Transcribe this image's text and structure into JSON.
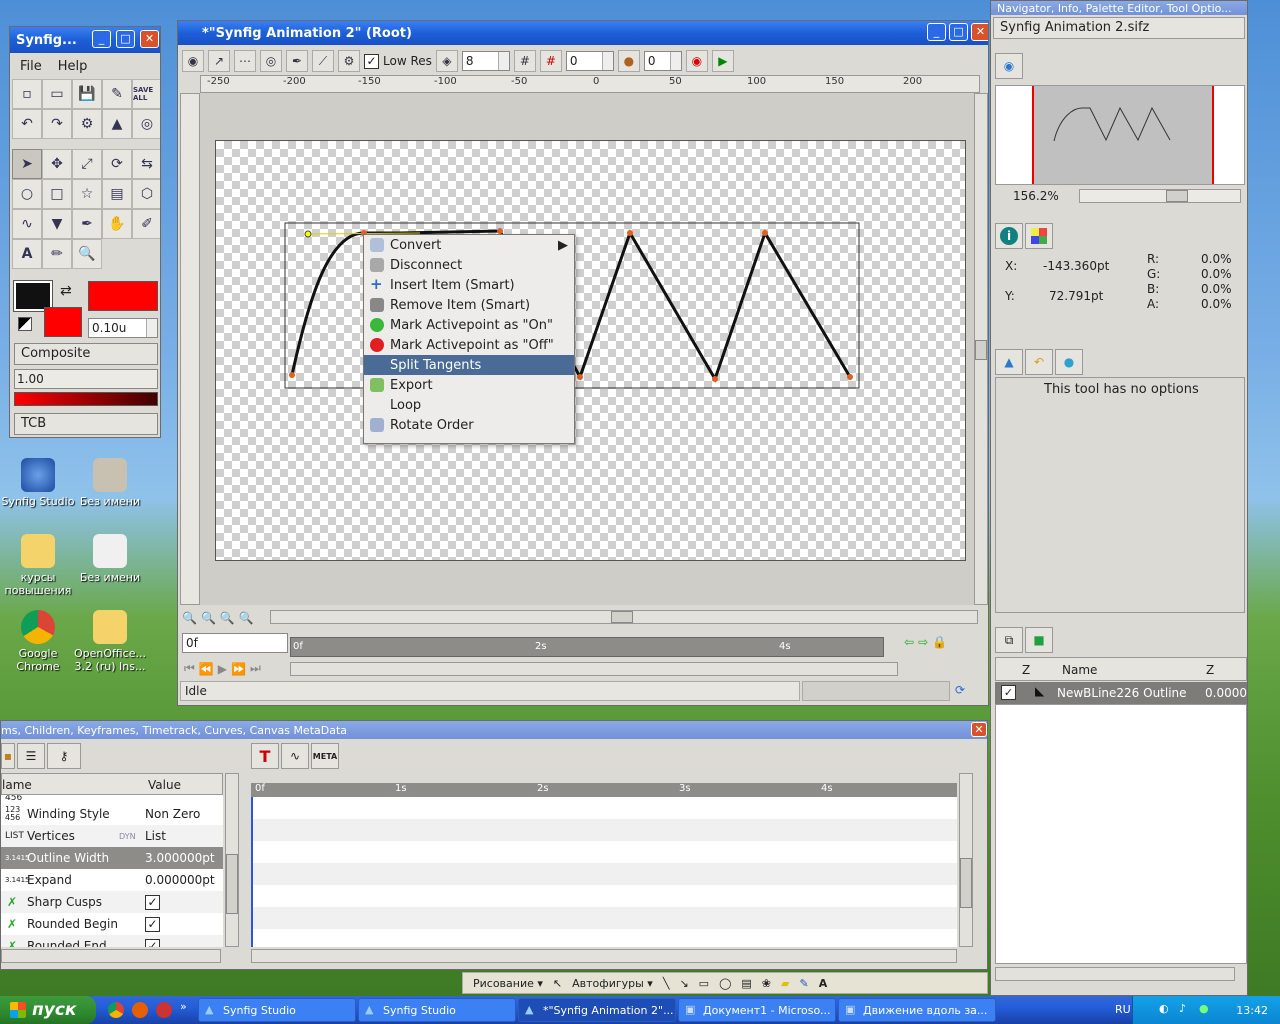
{
  "toolbox": {
    "title": "Synfig...",
    "menu": [
      "File",
      "Help"
    ],
    "save_all": "SAVE ALL",
    "width_value": "0.10u",
    "blend_method": "Composite",
    "amount": "1.00",
    "interpolation": "TCB",
    "colors": {
      "outline": "#111111",
      "fill": "#ff0000"
    }
  },
  "main_window": {
    "title": "*\"Synfig Animation 2\" (Root)",
    "low_res_label": "Low Res",
    "zoom_value": "8",
    "onion_past": "0",
    "onion_future": "0",
    "ruler_ticks": [
      "-250",
      "-200",
      "-150",
      "-100",
      "-50",
      "0",
      "50",
      "100",
      "150",
      "200"
    ],
    "time_field": "0f",
    "timeline_ticks": [
      "0f",
      "2s",
      "4s"
    ],
    "status": "Idle"
  },
  "context_menu": {
    "items": [
      {
        "label": "Convert",
        "icon": "convert-icon",
        "submenu": true
      },
      {
        "label": "Disconnect",
        "icon": "disconnect-icon"
      },
      {
        "label": "Insert Item (Smart)",
        "icon": "plus-icon"
      },
      {
        "label": "Remove Item (Smart)",
        "icon": "trash-icon"
      },
      {
        "label": "Mark Activepoint as \"On\"",
        "icon": "green-dot-icon"
      },
      {
        "label": "Mark Activepoint as \"Off\"",
        "icon": "red-dot-icon"
      },
      {
        "label": "Split Tangents",
        "icon": "",
        "selected": true
      },
      {
        "label": "Export",
        "icon": "export-icon"
      },
      {
        "label": "Loop",
        "icon": ""
      },
      {
        "label": "Rotate Order",
        "icon": "rotate-icon"
      }
    ]
  },
  "navigator": {
    "title": "Navigator, Info, Palette Editor, Tool Optio...",
    "file": "Synfig Animation 2.sifz",
    "zoom": "156.2%"
  },
  "info": {
    "x_label": "X:",
    "x_value": "-143.360pt",
    "y_label": "Y:",
    "y_value": "72.791pt",
    "r_label": "R:",
    "r_value": "0.0%",
    "g_label": "G:",
    "g_value": "0.0%",
    "b_label": "B:",
    "b_value": "0.0%",
    "a_label": "A:",
    "a_value": "0.0%"
  },
  "tool_options": {
    "message": "This tool has no options"
  },
  "layers": {
    "col_z": "Z",
    "col_name": "Name",
    "col_z2": "Z",
    "rows": [
      {
        "name": "NewBLine226 Outline",
        "z": "0.0000"
      }
    ]
  },
  "params": {
    "title": "ms, Children, Keyframes, Timetrack, Curves, Canvas MetaData",
    "col_name": "lame",
    "col_value": "Value",
    "top_cut": "456",
    "rows": [
      {
        "type": "123\n456",
        "name": "Winding Style",
        "value": "Non Zero"
      },
      {
        "type": "LIST",
        "name": "Vertices",
        "value": "List",
        "dyn": "DYN"
      },
      {
        "type": "3.1415",
        "name": "Outline Width",
        "value": "3.000000pt",
        "selected": true
      },
      {
        "type": "3.1415",
        "name": "Expand",
        "value": "0.000000pt"
      },
      {
        "type": "",
        "name": "Sharp Cusps",
        "value": "",
        "check": true
      },
      {
        "type": "",
        "name": "Rounded Begin",
        "value": "",
        "check": true
      },
      {
        "type": "",
        "name": "Rounded End",
        "value": "",
        "check": true
      }
    ],
    "timetrack_ticks": [
      "0f",
      "1s",
      "2s",
      "3s",
      "4s"
    ]
  },
  "desktop_icons": [
    {
      "label": "Synfig Studio"
    },
    {
      "label": "Без имени"
    },
    {
      "label": "курсы повышения"
    },
    {
      "label": "Без имени"
    },
    {
      "label": "Google Chrome"
    },
    {
      "label": "OpenOffice... 3.2 (ru) Ins..."
    }
  ],
  "word_toolbar": {
    "draw": "Рисование ▾",
    "autoshapes": "Автофигуры ▾"
  },
  "taskbar": {
    "start": "пуск",
    "buttons": [
      {
        "label": "Synfig Studio"
      },
      {
        "label": "Synfig Studio"
      },
      {
        "label": "*\"Synfig Animation 2\"...",
        "active": true
      },
      {
        "label": "Документ1 - Microso..."
      },
      {
        "label": "Движение вдоль за..."
      }
    ],
    "lang": "RU",
    "clock": "13:42"
  }
}
